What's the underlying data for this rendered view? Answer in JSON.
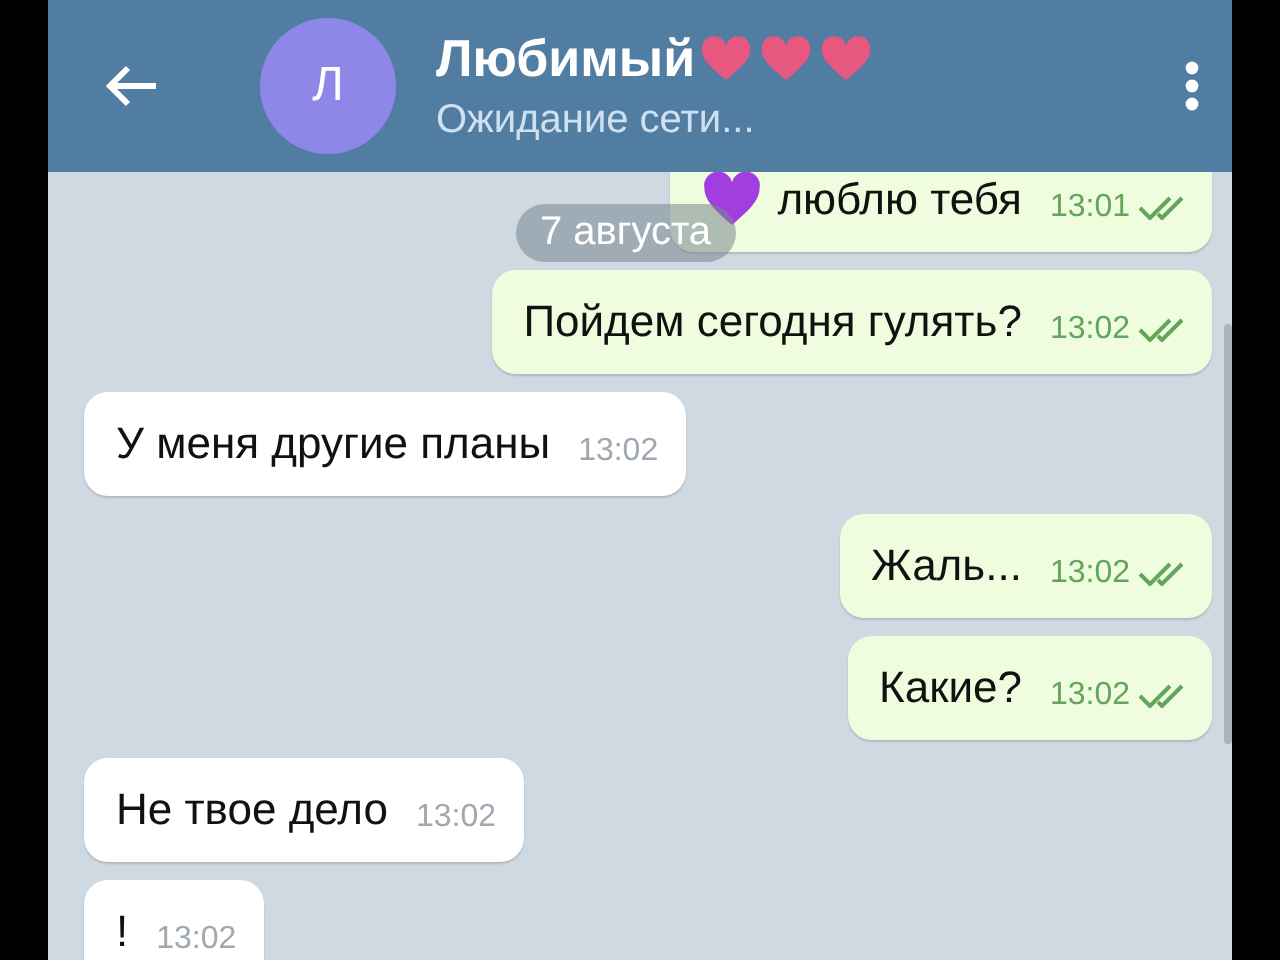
{
  "header": {
    "avatar_letter": "Л",
    "title": "Любимый",
    "status": "Ожидание сети..."
  },
  "date_pill": "7 августа",
  "messages": [
    {
      "kind": "outgoing",
      "text": "люблю тебя",
      "time": "13:01",
      "read": true,
      "heart": true
    },
    {
      "kind": "outgoing",
      "text": "Пойдем сегодня гулять?",
      "time": "13:02",
      "read": true,
      "heart": false
    },
    {
      "kind": "incoming",
      "text": "У меня другие планы",
      "time": "13:02",
      "read": false,
      "heart": false
    },
    {
      "kind": "outgoing",
      "text": "Жаль...",
      "time": "13:02",
      "read": true,
      "heart": false
    },
    {
      "kind": "outgoing",
      "text": "Какие?",
      "time": "13:02",
      "read": true,
      "heart": false
    },
    {
      "kind": "incoming",
      "text": "Не твое дело",
      "time": "13:02",
      "read": false,
      "heart": false
    },
    {
      "kind": "incoming",
      "text": "!",
      "time": "13:02",
      "read": false,
      "heart": false
    }
  ]
}
